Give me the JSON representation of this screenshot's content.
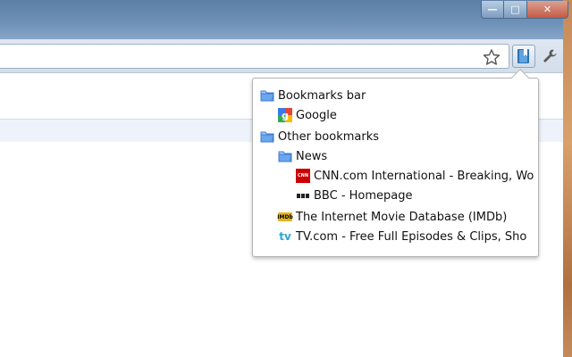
{
  "window": {
    "minimize_glyph": "—",
    "maximize_glyph": "□",
    "close_glyph": "✕"
  },
  "toolbar": {
    "star_icon": "star-icon",
    "bookmarks_icon": "bookmarks-icon",
    "wrench_icon": "wrench-icon"
  },
  "popup": {
    "items": [
      {
        "label": "Bookmarks bar",
        "icon": "folder-icon"
      },
      {
        "label": "Google",
        "icon": "google-favicon"
      },
      {
        "label": "Other bookmarks",
        "icon": "folder-icon"
      },
      {
        "label": "News",
        "icon": "folder-icon"
      },
      {
        "label": "CNN.com International - Breaking, Wo",
        "icon": "cnn-favicon"
      },
      {
        "label": "BBC - Homepage",
        "icon": "bbc-favicon"
      },
      {
        "label": "The Internet Movie Database (IMDb)",
        "icon": "imdb-favicon"
      },
      {
        "label": "TV.com - Free Full Episodes & Clips, Sho",
        "icon": "tv-favicon"
      }
    ],
    "favicons": {
      "cnn_text": "CNN",
      "imdb_text": "IMDb",
      "tv_text": "tv"
    }
  },
  "colors": {
    "folder": "#3d7bd9",
    "accent": "#2aa5d6"
  }
}
